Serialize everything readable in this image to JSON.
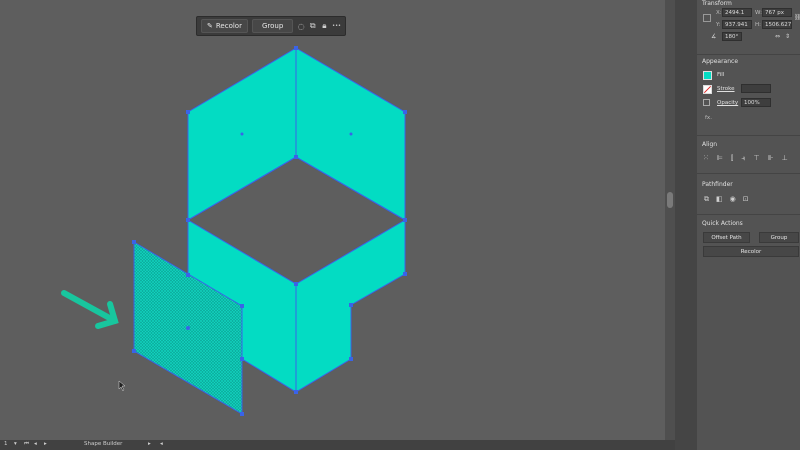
{
  "toolbar": {
    "recolor_label": "Recolor",
    "group_label": "Group",
    "more_glyph": "•••"
  },
  "transform": {
    "title": "Transform",
    "x_label": "X:",
    "x_value": "2494.1 px",
    "y_label": "Y:",
    "y_value": "937.941 p",
    "w_label": "W:",
    "w_value": "767 px",
    "h_label": "H:",
    "h_value": "1506.627",
    "angle_value": "180°"
  },
  "appearance": {
    "title": "Appearance",
    "fill_label": "Fill",
    "fill_color": "#03dcc3",
    "stroke_label": "Stroke",
    "opacity_label": "Opacity",
    "opacity_value": "100%",
    "fx_label": "fx."
  },
  "align": {
    "title": "Align"
  },
  "pathfinder": {
    "title": "Pathfinder"
  },
  "quick_actions": {
    "title": "Quick Actions",
    "offset_path_label": "Offset Path",
    "group_label": "Group",
    "recolor_label": "Recolor"
  },
  "statusbar": {
    "zoom": "1",
    "tool_name": "Shape Builder"
  },
  "colors": {
    "artwork_fill": "#03dcc3",
    "selection": "#3a63e8",
    "arrow": "#18c69e"
  }
}
